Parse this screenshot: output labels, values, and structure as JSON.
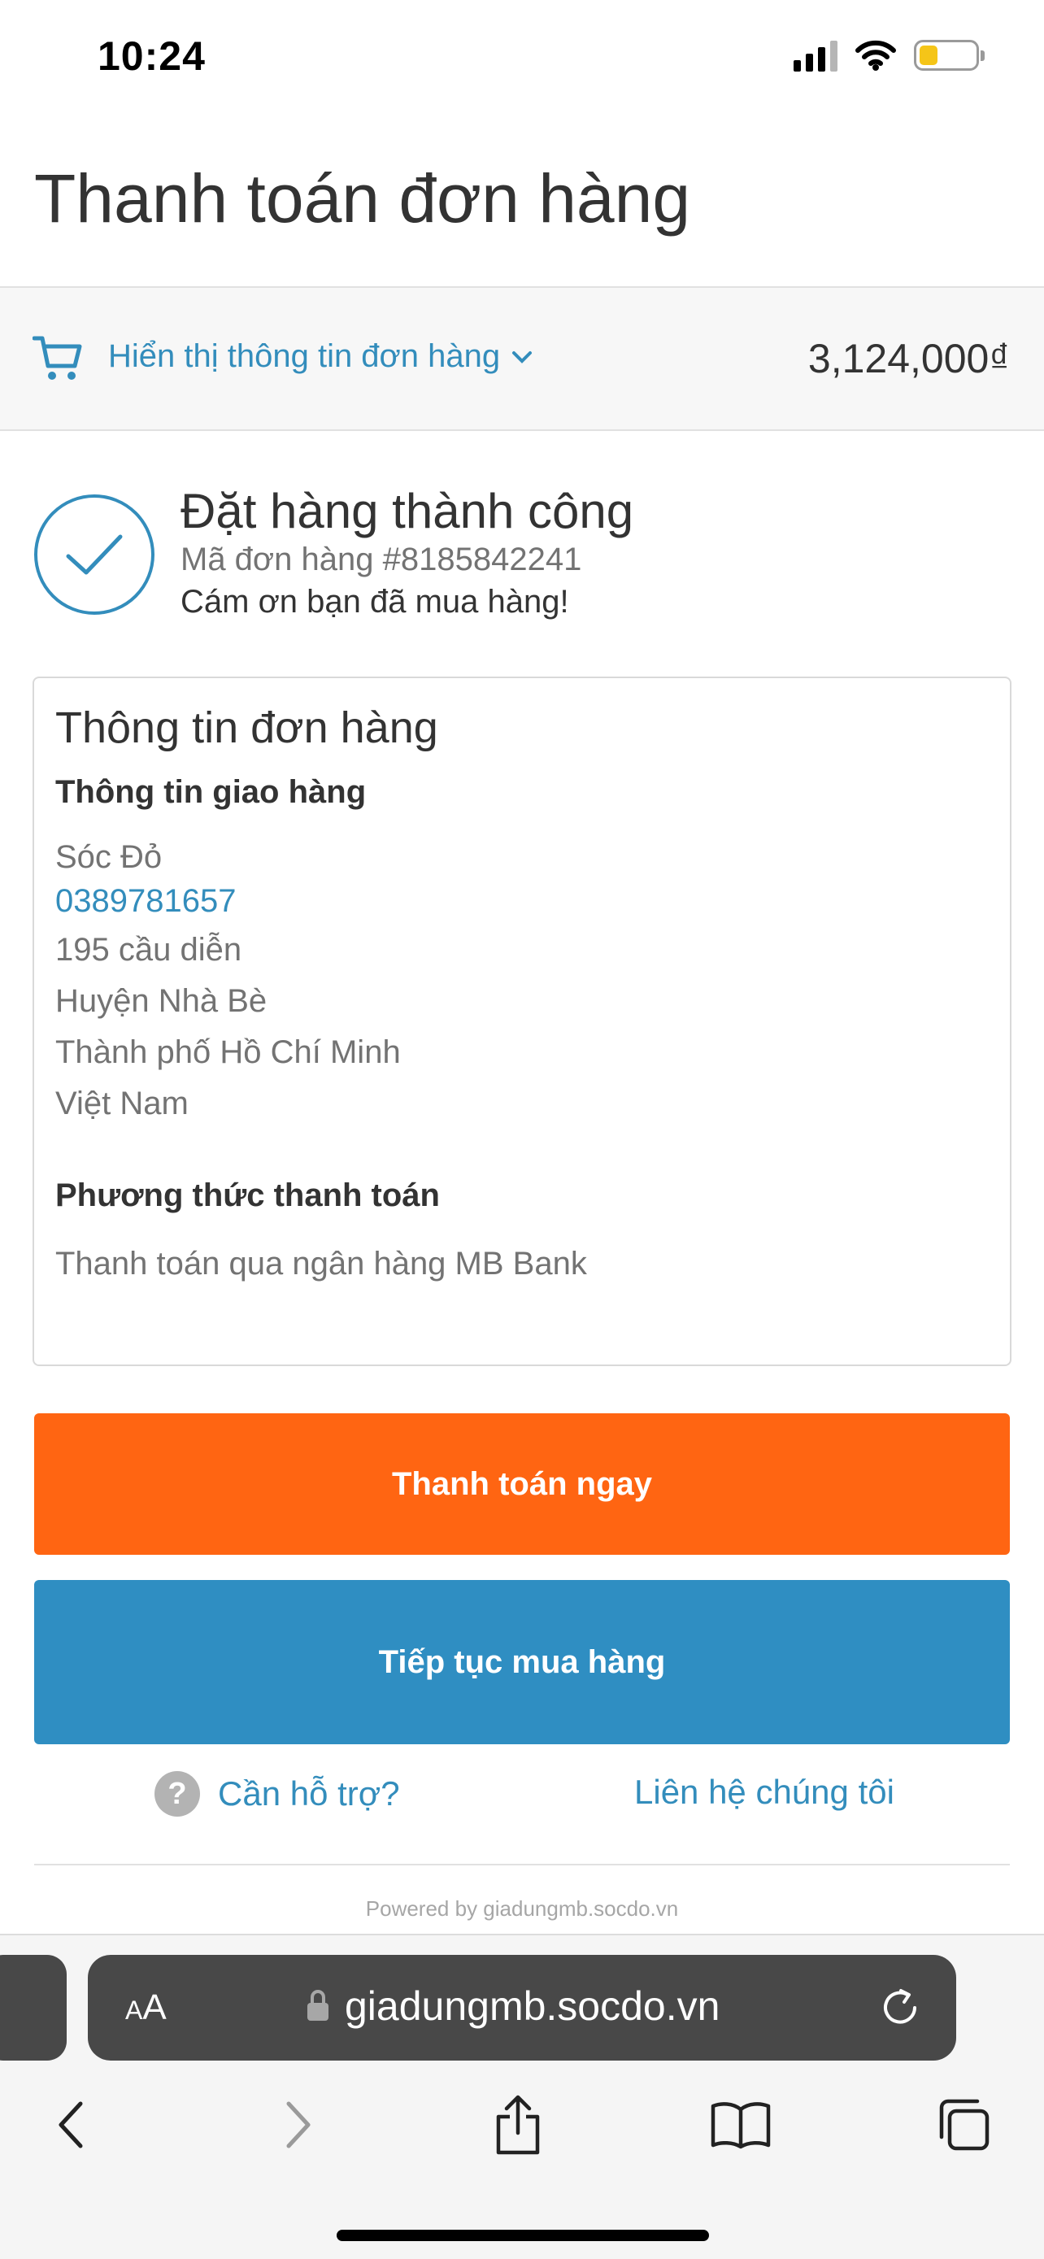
{
  "status_bar": {
    "time": "10:24"
  },
  "header": {
    "title": "Thanh toán đơn hàng"
  },
  "order_summary": {
    "toggle_label": "Hiển thị thông tin đơn hàng",
    "total": "3,124,000₫"
  },
  "success": {
    "title": "Đặt hàng thành công",
    "order_id": "Mã đơn hàng #8185842241",
    "thanks": "Cám ơn bạn đã mua hàng!"
  },
  "order_info": {
    "title": "Thông tin đơn hàng",
    "shipping_heading": "Thông tin giao hàng",
    "name": "Sóc Đỏ",
    "phone": "0389781657",
    "address": [
      "195 cầu diễn",
      "Huyện Nhà Bè",
      "Thành phố Hồ Chí Minh",
      "Việt Nam"
    ],
    "payment_heading": "Phương thức thanh toán",
    "payment_method": "Thanh toán qua ngân hàng MB Bank"
  },
  "buttons": {
    "pay_now": "Thanh toán ngay",
    "continue_shopping": "Tiếp tục mua hàng"
  },
  "support": {
    "help_label": "Cần hỗ trợ?",
    "help_icon_glyph": "?",
    "contact_label": "Liên hệ chúng tôi"
  },
  "footer": {
    "powered_by": "Powered by giadungmb.socdo.vn"
  },
  "browser": {
    "aa_small": "A",
    "aa_large": "A",
    "url": "giadungmb.socdo.vn"
  },
  "colors": {
    "link": "#338dbc",
    "pay_button": "#ff6512",
    "continue_button": "#2f8ec2",
    "battery": "#f5c518"
  }
}
